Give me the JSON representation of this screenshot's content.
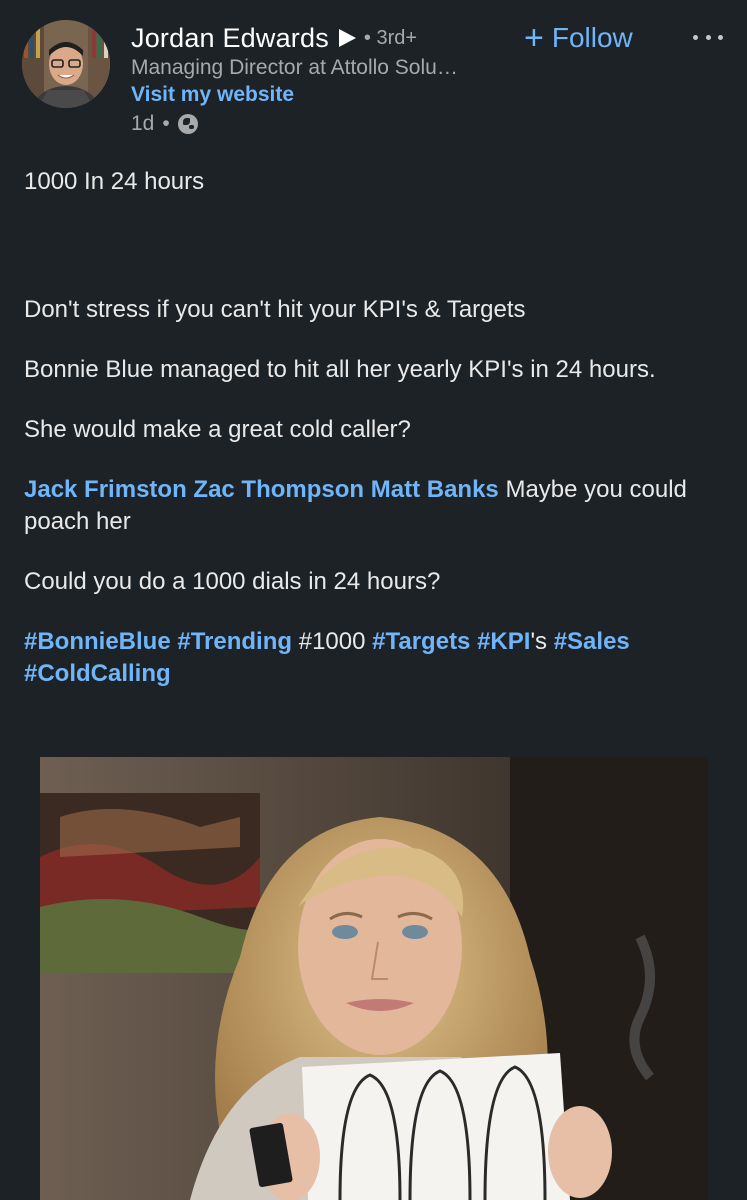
{
  "author": {
    "name": "Jordan Edwards",
    "degree": "• 3rd+",
    "headline": "Managing Director at Attollo Solu…",
    "website_label": "Visit my website",
    "time": "1d",
    "time_sep": "•",
    "visibility_icon": "globe-icon"
  },
  "actions": {
    "follow_plus": "+",
    "follow_label": "Follow",
    "more_icon": "ellipsis-icon"
  },
  "post": {
    "line1": "1000 In 24 hours",
    "line2": "Don't stress if you can't hit your KPI's & Targets",
    "line3": "Bonnie Blue managed to hit all her yearly KPI's in 24 hours.",
    "line4": "She would make a great cold caller?",
    "mentions": [
      "Jack Frimston",
      "Zac Thompson",
      "Matt Banks"
    ],
    "mention_suffix": "Maybe you could poach her",
    "line6": "Could you do a 1000 dials in 24 hours?",
    "hashtags": {
      "h1": "#BonnieBlue",
      "h2": "#Trending",
      "h3": "#1000",
      "h4": "#Targets",
      "h5": "#KPI",
      "h5_suffix": "'s",
      "h6": "#Sales",
      "h7": "#ColdCalling"
    }
  },
  "colors": {
    "background": "#1d2226",
    "link": "#70b5f9",
    "text": "#e9e9e9",
    "muted": "#a7a9ab"
  }
}
